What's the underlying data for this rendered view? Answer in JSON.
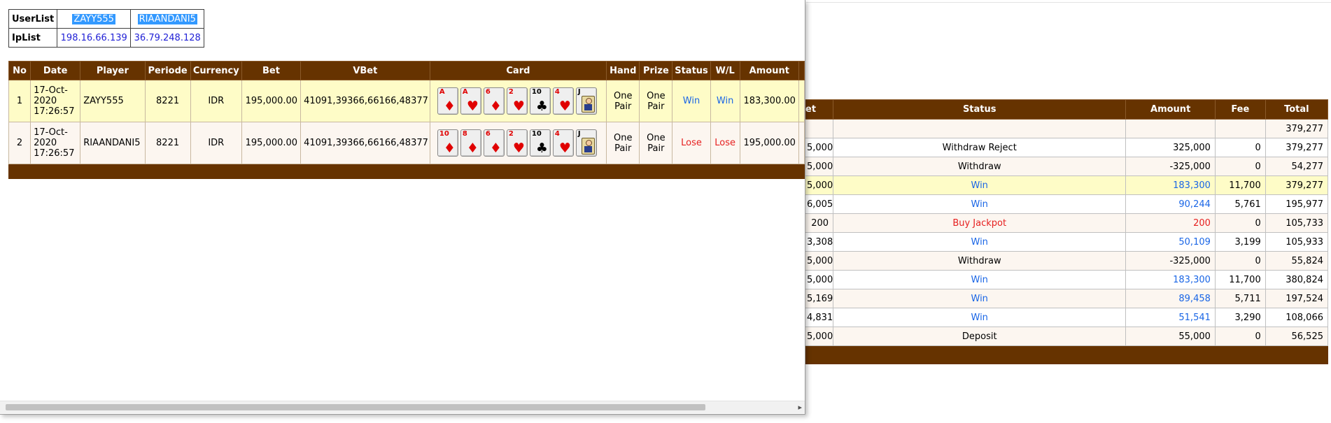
{
  "background": {
    "headers": [
      "et",
      "Status",
      "Amount",
      "Fee",
      "Total"
    ],
    "rows": [
      {
        "bet": "",
        "status": "",
        "amount": "",
        "fee": "",
        "total": "379,277",
        "color": ""
      },
      {
        "bet": "5,000",
        "status": "Withdraw Reject",
        "amount": "325,000",
        "fee": "0",
        "total": "379,277",
        "color": ""
      },
      {
        "bet": "5,000",
        "status": "Withdraw",
        "amount": "-325,000",
        "fee": "0",
        "total": "54,277",
        "color": ""
      },
      {
        "bet": "5,000",
        "status": "Win",
        "amount": "183,300",
        "fee": "11,700",
        "total": "379,277",
        "color": "blue"
      },
      {
        "bet": "6,005",
        "status": "Win",
        "amount": "90,244",
        "fee": "5,761",
        "total": "195,977",
        "color": "blue"
      },
      {
        "bet": "200",
        "status": "Buy Jackpot",
        "amount": "200",
        "fee": "0",
        "total": "105,733",
        "color": "red"
      },
      {
        "bet": "3,308",
        "status": "Win",
        "amount": "50,109",
        "fee": "3,199",
        "total": "105,933",
        "color": "blue"
      },
      {
        "bet": "5,000",
        "status": "Withdraw",
        "amount": "-325,000",
        "fee": "0",
        "total": "55,824",
        "color": ""
      },
      {
        "bet": "5,000",
        "status": "Win",
        "amount": "183,300",
        "fee": "11,700",
        "total": "380,824",
        "color": "blue"
      },
      {
        "bet": "5,169",
        "status": "Win",
        "amount": "89,458",
        "fee": "5,711",
        "total": "197,524",
        "color": "blue"
      },
      {
        "bet": "4,831",
        "status": "Win",
        "amount": "51,541",
        "fee": "3,290",
        "total": "108,066",
        "color": "blue"
      },
      {
        "bet": "5,000",
        "status": "Deposit",
        "amount": "55,000",
        "fee": "0",
        "total": "56,525",
        "color": ""
      }
    ]
  },
  "popup": {
    "userlist_label": "UserList",
    "iplist_label": "IpList",
    "users": [
      "ZAYY555",
      "RIAANDANI5"
    ],
    "ips": [
      "198.16.66.139",
      "36.79.248.128"
    ],
    "headers": [
      "No",
      "Date",
      "Player",
      "Periode",
      "Currency",
      "Bet",
      "VBet",
      "Card",
      "Hand",
      "Prize",
      "Status",
      "W/L",
      "Amount"
    ],
    "rows": [
      {
        "no": "1",
        "date": "17-Oct-2020 17:26:57",
        "player": "ZAYY555",
        "periode": "8221",
        "currency": "IDR",
        "bet": "195,000.00",
        "vbet": "41091,39366,66166,48377",
        "cards": [
          {
            "rank": "A",
            "suit": "diamond-icon",
            "glyph": "♦",
            "color": "red"
          },
          {
            "rank": "A",
            "suit": "heart-icon",
            "glyph": "♥",
            "color": "red"
          },
          {
            "rank": "6",
            "suit": "diamond-icon",
            "glyph": "♦",
            "color": "red"
          },
          {
            "rank": "2",
            "suit": "heart-icon",
            "glyph": "♥",
            "color": "red"
          },
          {
            "rank": "10",
            "suit": "club-icon",
            "glyph": "♣",
            "color": "black"
          },
          {
            "rank": "4",
            "suit": "heart-icon",
            "glyph": "♥",
            "color": "red"
          },
          {
            "rank": "J",
            "suit": "jack-face-icon",
            "glyph": "",
            "color": "black"
          }
        ],
        "hand": "One Pair",
        "prize": "One Pair",
        "status": "Win",
        "wl": "Win",
        "amount": "183,300.00",
        "status_color": "blue"
      },
      {
        "no": "2",
        "date": "17-Oct-2020 17:26:57",
        "player": "RIAANDANI5",
        "periode": "8221",
        "currency": "IDR",
        "bet": "195,000.00",
        "vbet": "41091,39366,66166,48377",
        "cards": [
          {
            "rank": "10",
            "suit": "diamond-icon",
            "glyph": "♦",
            "color": "red"
          },
          {
            "rank": "8",
            "suit": "diamond-icon",
            "glyph": "♦",
            "color": "red"
          },
          {
            "rank": "6",
            "suit": "diamond-icon",
            "glyph": "♦",
            "color": "red"
          },
          {
            "rank": "2",
            "suit": "heart-icon",
            "glyph": "♥",
            "color": "red"
          },
          {
            "rank": "10",
            "suit": "club-icon",
            "glyph": "♣",
            "color": "black"
          },
          {
            "rank": "4",
            "suit": "heart-icon",
            "glyph": "♥",
            "color": "red"
          },
          {
            "rank": "J",
            "suit": "jack-face-icon",
            "glyph": "",
            "color": "black"
          }
        ],
        "hand": "One Pair",
        "prize": "One Pair",
        "status": "Lose",
        "wl": "Lose",
        "amount": "195,000.00",
        "status_color": "red"
      }
    ]
  },
  "colors": {
    "header_brown": "#663300",
    "win_blue": "#1a66e6",
    "lose_red": "#e62020",
    "highlight_yellow": "#fefcc7"
  }
}
